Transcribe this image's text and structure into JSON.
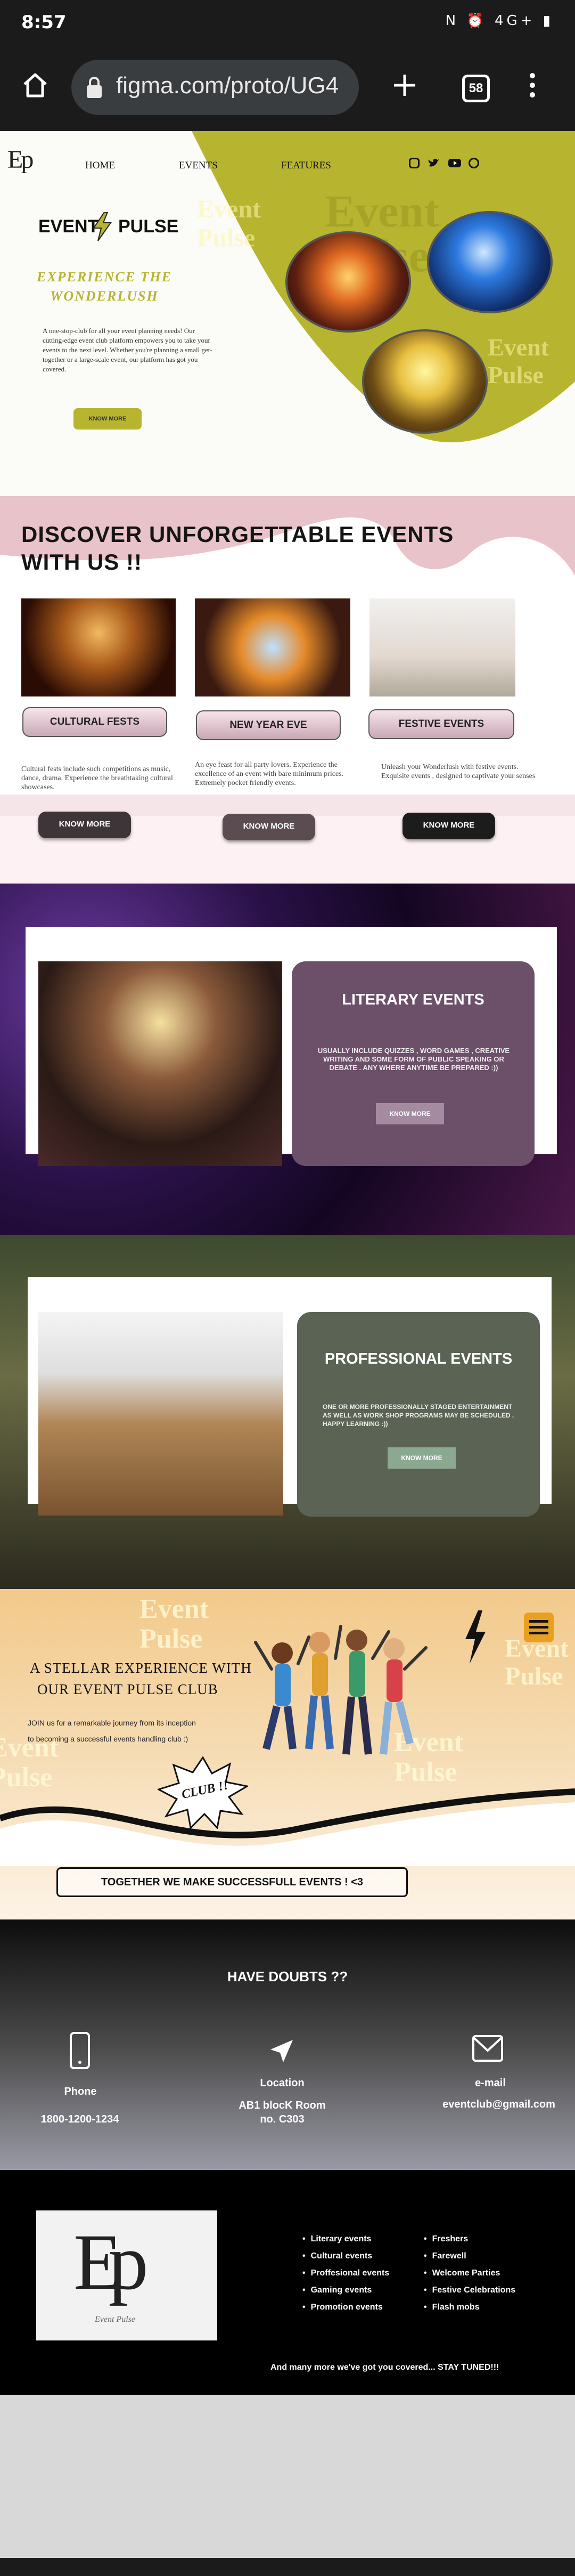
{
  "status_bar": {
    "time": "8:57",
    "icons_text": "N ⏰ 4G+ ▮"
  },
  "browser": {
    "url": "figma.com/proto/UG4",
    "tab_count": "58"
  },
  "nav": {
    "logo_text": "Ep",
    "links": [
      "HOME",
      "EVENTS",
      "FEATURES"
    ]
  },
  "hero": {
    "brand_left": "EVENT",
    "brand_right": "PULSE",
    "tagline_line1": "EXPERIENCE   THE",
    "tagline_line2": "WONDERLUSH",
    "desc": "A one-stop-club for all your event planning needs! Our cutting-edge event club platform empowers you to take your events to the next level. Whether you're planning a small get-together or a large-scale event, our platform has got you covered.",
    "button": "KNOW MORE",
    "ghost_text_1": "Event",
    "ghost_text_2": "Pulse",
    "ghost_text_3": "Event",
    "ghost_text_4": "Pulse"
  },
  "discover": {
    "title_line1": "DISCOVER  UNFORGETTABLE  EVENTS",
    "title_line2": "WITH US !!",
    "cards": [
      {
        "label": "CULTURAL FESTS",
        "desc": "Cultural fests include such competitions as music, dance, drama. Experience the breathtaking cultural showcases.",
        "button": "KNOW MORE"
      },
      {
        "label": "NEW YEAR EVE",
        "desc": "An eye feast for all party lovers. Experience the excellence of an event with bare minimum prices. Extremely pocket friendly events.",
        "button": "KNOW MORE"
      },
      {
        "label": "FESTIVE EVENTS",
        "desc": "Unleash your Wonderlush with festive events. Exquisite events , designed to captivate your senses",
        "button": "KNOW MORE"
      }
    ]
  },
  "literary": {
    "title": "LITERARY EVENTS",
    "desc": "USUALLY INCLUDE QUIZZES , WORD GAMES , CREATIVE WRITING AND SOME FORM OF PUBLIC SPEAKING OR DEBATE . ANY WHERE ANYTIME BE PREPARED :))",
    "button": "KNOW MORE"
  },
  "professional": {
    "title": "PROFESSIONAL EVENTS",
    "desc": "ONE OR MORE PROFESSIONALLY STAGED ENTERTAINMENT AS WELL AS WORK SHOP PROGRAMS MAY BE SCHEDULED . HAPPY LEARNING :))",
    "button": "KNOW MORE"
  },
  "stellar": {
    "heading_line1": "A  STELLAR  EXPERIENCE  WITH",
    "heading_line2": "OUR  EVENT  PULSE  CLUB",
    "join_line1": "JOIN us for a remarkable journey from its inception",
    "join_line2": "to becoming a successful events handling club :)",
    "badge": "CLUB !!",
    "banner": "TOGETHER  WE MAKE SUCCESSFULL EVENTS ! <3",
    "ghost_1": "Event",
    "ghost_2": "Pulse"
  },
  "contact": {
    "title": "HAVE DOUBTS ??",
    "items": [
      {
        "label": "Phone",
        "value": "1800-1200-1234"
      },
      {
        "label": "Location",
        "value": "AB1 blocK Room\nno. C303"
      },
      {
        "label": "e-mail",
        "value": "eventclub@gmail.com"
      }
    ]
  },
  "footer": {
    "logo_letters": "Ep",
    "logo_script": "Event Pulse",
    "col1": [
      "Literary events",
      "Cultural events",
      "Proffesional events",
      "Gaming events",
      "Promotion events"
    ],
    "col2": [
      "Freshers",
      "Farewell",
      "Welcome Parties",
      "Festive Celebrations",
      "Flash mobs"
    ],
    "tagline": "And  many  more  we've got you covered... STAY TUNED!!!"
  },
  "colors": {
    "olive": "#b7b430",
    "pink": "#e9c3ca",
    "purple_card": "#6c4f68",
    "green_card": "#5a6354"
  }
}
